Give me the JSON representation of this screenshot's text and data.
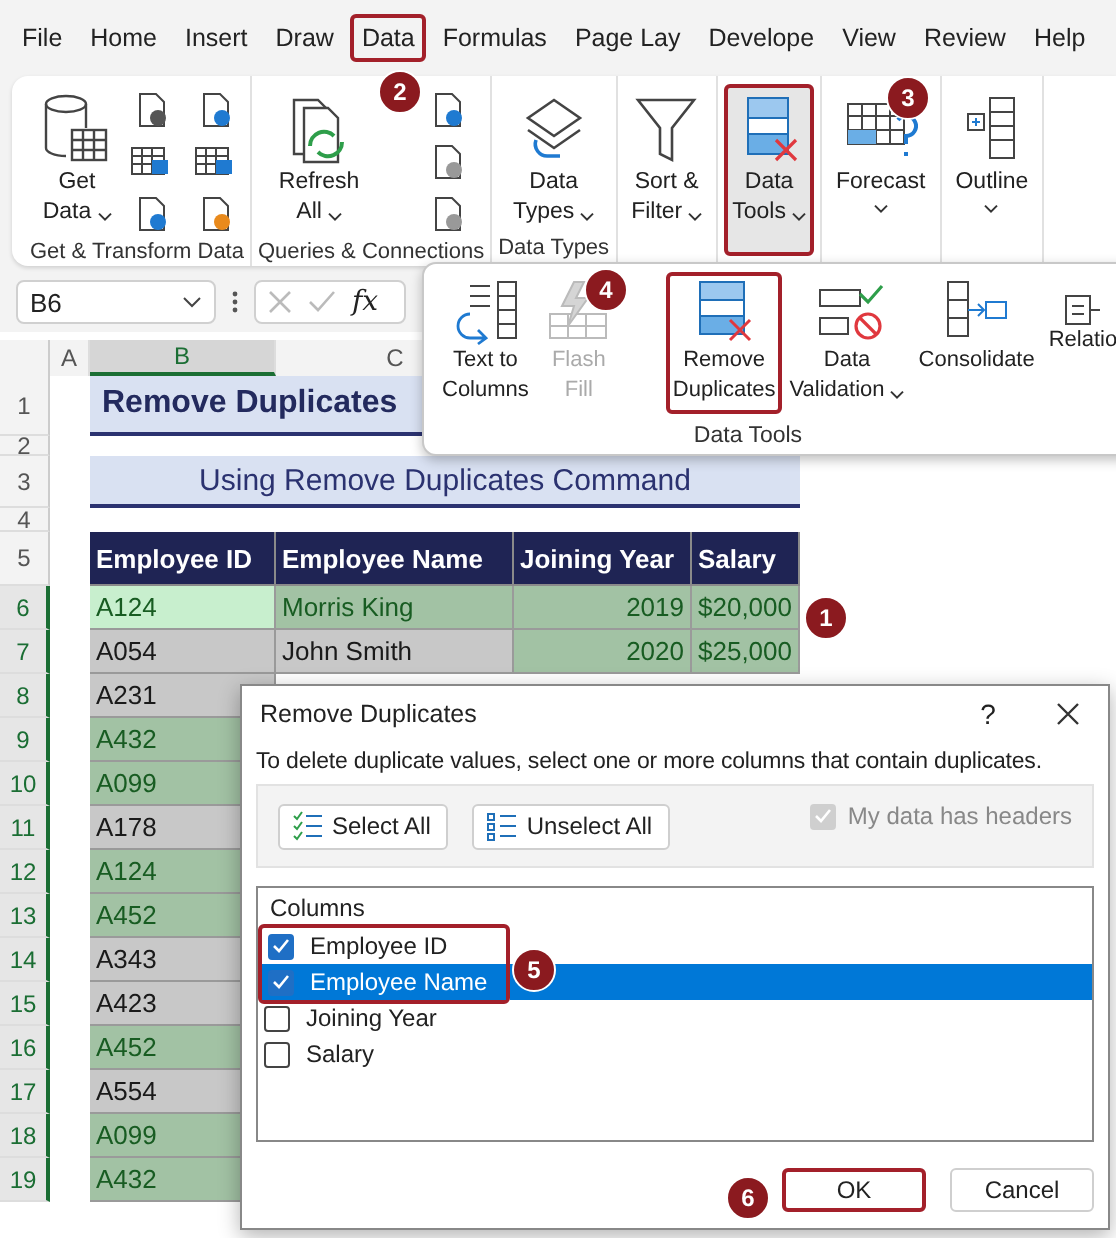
{
  "menu_tabs": [
    {
      "label": "File",
      "highlighted": false
    },
    {
      "label": "Home",
      "highlighted": false
    },
    {
      "label": "Insert",
      "highlighted": false
    },
    {
      "label": "Draw",
      "highlighted": false
    },
    {
      "label": "Data",
      "highlighted": true
    },
    {
      "label": "Formulas",
      "highlighted": false
    },
    {
      "label": "Page Lay",
      "highlighted": false
    },
    {
      "label": "Develope",
      "highlighted": false
    },
    {
      "label": "View",
      "highlighted": false
    },
    {
      "label": "Review",
      "highlighted": false
    },
    {
      "label": "Help",
      "highlighted": false
    }
  ],
  "ribbon_groups": [
    {
      "label": "Get & Transform Data",
      "buttons": [
        {
          "kind": "large",
          "lines": [
            "Get",
            "Data"
          ],
          "dropdown": true,
          "highlighted": false
        },
        {
          "kind": "small"
        },
        {
          "kind": "small"
        },
        {
          "kind": "small"
        },
        {
          "kind": "small"
        },
        {
          "kind": "small"
        },
        {
          "kind": "small"
        }
      ]
    },
    {
      "label": "Queries & Connections",
      "buttons": [
        {
          "kind": "large",
          "lines": [
            "Refresh",
            "All"
          ],
          "dropdown": true,
          "highlighted": false
        },
        {
          "kind": "small"
        },
        {
          "kind": "small"
        },
        {
          "kind": "small"
        }
      ]
    },
    {
      "label": "Data Types",
      "buttons": [
        {
          "kind": "large",
          "lines": [
            "Data",
            "Types"
          ],
          "dropdown": true,
          "highlighted": false
        }
      ]
    },
    {
      "buttons": [
        {
          "kind": "large",
          "lines": [
            "Sort &",
            "Filter"
          ],
          "dropdown": true,
          "highlighted": false
        }
      ]
    },
    {
      "buttons": [
        {
          "kind": "large",
          "lines": [
            "Data",
            "Tools"
          ],
          "dropdown": true,
          "highlighted": true
        }
      ]
    },
    {
      "buttons": [
        {
          "kind": "large",
          "lines": [
            "Forecast"
          ],
          "dropdown": true,
          "highlighted": false
        }
      ]
    },
    {
      "buttons": [
        {
          "kind": "large",
          "lines": [
            "Outline"
          ],
          "dropdown": true,
          "highlighted": false
        }
      ]
    }
  ],
  "data_tools_popup": {
    "label": "Data Tools",
    "buttons": [
      {
        "lines": [
          "Text to",
          "Columns"
        ],
        "dropdown": false,
        "disabled": false,
        "highlighted": false
      },
      {
        "lines": [
          "Flash",
          "Fill"
        ],
        "dropdown": false,
        "disabled": true,
        "highlighted": false
      },
      {
        "lines": [
          "Remove",
          "Duplicates"
        ],
        "dropdown": false,
        "disabled": false,
        "highlighted": true
      },
      {
        "lines": [
          "Data",
          "Validation"
        ],
        "dropdown": true,
        "disabled": false,
        "highlighted": false
      },
      {
        "lines": [
          "Consolidate"
        ],
        "dropdown": false,
        "disabled": false,
        "highlighted": false
      },
      {
        "lines": [
          "Relatio"
        ],
        "dropdown": false,
        "disabled": false,
        "highlighted": false
      }
    ]
  },
  "formula_bar": {
    "name_box": "B6",
    "function_label": "fx"
  },
  "sheet": {
    "column_headers": [
      "A",
      "B",
      "C"
    ],
    "title": {
      "row": "1",
      "text": "Remove Duplicates"
    },
    "row_2": "2",
    "subtitle": {
      "row": "3",
      "text": "Using Remove Duplicates Command"
    },
    "row_4": "4",
    "header": {
      "row": "5",
      "cells": [
        "Employee ID",
        "Employee Name",
        "Joining Year",
        "Salary"
      ]
    },
    "rows": [
      {
        "row": "6",
        "cells": [
          {
            "text": "A124",
            "highlighted": true,
            "active": true
          },
          {
            "text": "Morris King",
            "highlighted": true,
            "active": false
          },
          {
            "text": "2019",
            "highlighted": true,
            "active": false
          },
          {
            "text": "$20,000",
            "highlighted": true,
            "active": false
          }
        ]
      },
      {
        "row": "7",
        "cells": [
          {
            "text": "A054",
            "highlighted": false,
            "active": false
          },
          {
            "text": "John Smith",
            "highlighted": false,
            "active": false
          },
          {
            "text": "2020",
            "highlighted": true,
            "active": false
          },
          {
            "text": "$25,000",
            "highlighted": true,
            "active": false
          }
        ]
      },
      {
        "row": "8",
        "cells": [
          {
            "text": "A231",
            "highlighted": false,
            "active": false
          }
        ]
      },
      {
        "row": "9",
        "cells": [
          {
            "text": "A432",
            "highlighted": true,
            "active": false
          }
        ]
      },
      {
        "row": "10",
        "cells": [
          {
            "text": "A099",
            "highlighted": true,
            "active": false
          }
        ]
      },
      {
        "row": "11",
        "cells": [
          {
            "text": "A178",
            "highlighted": false,
            "active": false
          }
        ]
      },
      {
        "row": "12",
        "cells": [
          {
            "text": "A124",
            "highlighted": true,
            "active": false
          }
        ]
      },
      {
        "row": "13",
        "cells": [
          {
            "text": "A452",
            "highlighted": true,
            "active": false
          }
        ]
      },
      {
        "row": "14",
        "cells": [
          {
            "text": "A343",
            "highlighted": false,
            "active": false
          }
        ]
      },
      {
        "row": "15",
        "cells": [
          {
            "text": "A423",
            "highlighted": false,
            "active": false
          }
        ]
      },
      {
        "row": "16",
        "cells": [
          {
            "text": "A452",
            "highlighted": true,
            "active": false
          }
        ]
      },
      {
        "row": "17",
        "cells": [
          {
            "text": "A554",
            "highlighted": false,
            "active": false
          }
        ]
      },
      {
        "row": "18",
        "cells": [
          {
            "text": "A099",
            "highlighted": true,
            "active": false
          }
        ]
      },
      {
        "row": "19",
        "cells": [
          {
            "text": "A432",
            "highlighted": true,
            "active": false
          }
        ]
      }
    ]
  },
  "dialog": {
    "title": "Remove Duplicates",
    "help": "?",
    "description": "To delete duplicate values, select one or more columns that contain duplicates.",
    "select_all": "Select All",
    "unselect_all": "Unselect All",
    "headers_checkbox": {
      "label": "My data has headers",
      "checked": true,
      "disabled": true
    },
    "list_header": "Columns",
    "columns": [
      {
        "label": "Employee ID",
        "checked": true,
        "selected": false,
        "highlighted": true
      },
      {
        "label": "Employee Name",
        "checked": true,
        "selected": true,
        "highlighted": true
      },
      {
        "label": "Joining Year",
        "checked": false,
        "selected": false,
        "highlighted": false
      },
      {
        "label": "Salary",
        "checked": false,
        "selected": false,
        "highlighted": false
      }
    ],
    "ok": {
      "label": "OK",
      "highlighted": true
    },
    "cancel": {
      "label": "Cancel",
      "highlighted": false
    }
  },
  "callouts": [
    "1",
    "2",
    "3",
    "4",
    "5",
    "6"
  ]
}
